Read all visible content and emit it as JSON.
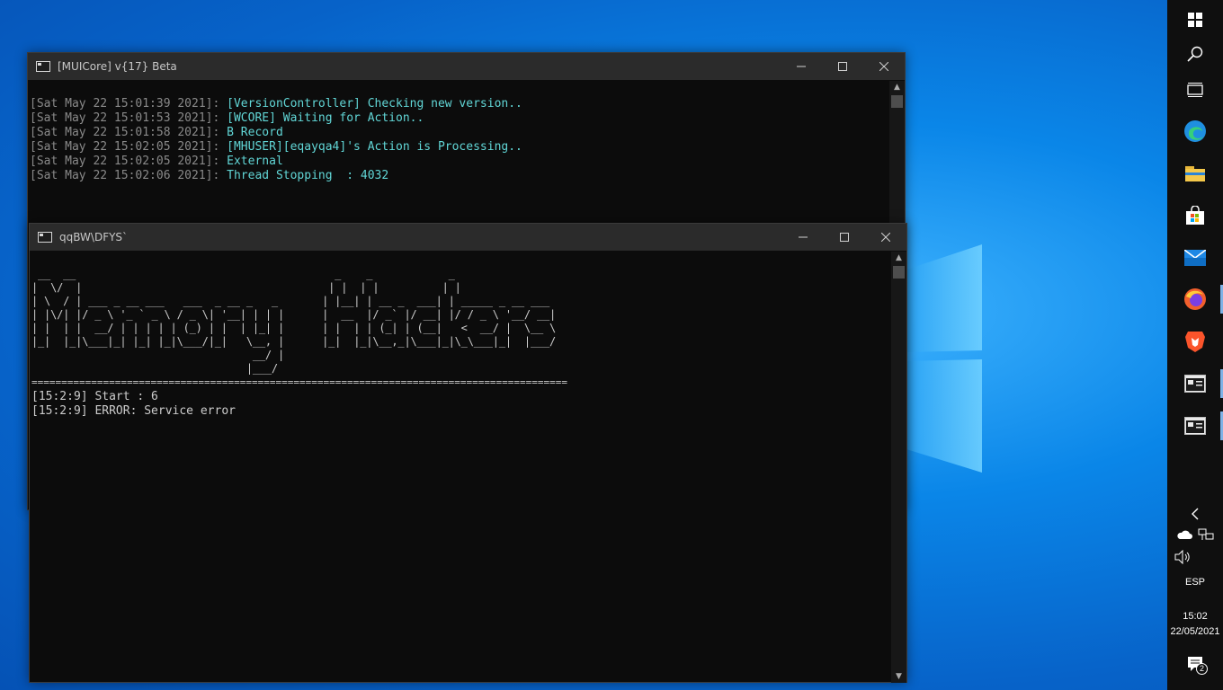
{
  "window1": {
    "title": "[MUICore] v{17} Beta",
    "lines": [
      {
        "ts": "[Sat May 22 15:01:39 2021]: ",
        "msg": "[VersionController] Checking new version.."
      },
      {
        "ts": "[Sat May 22 15:01:53 2021]: ",
        "msg": "[WCORE] Waiting for Action.."
      },
      {
        "ts": "[Sat May 22 15:01:58 2021]: ",
        "msg": "B Record"
      },
      {
        "ts": "[Sat May 22 15:02:05 2021]: ",
        "msg": "[MHUSER][eqayqa4]'s Action is Processing.."
      },
      {
        "ts": "[Sat May 22 15:02:05 2021]: ",
        "msg": "External"
      },
      {
        "ts": "[Sat May 22 15:02:06 2021]: ",
        "msg": "Thread Stopping  : 4032"
      }
    ]
  },
  "window2": {
    "title": "qqBW\\DFYS`",
    "banner": " __  __                                         _    _            _\n|  \\/  |                                       | |  | |          | |\n| \\  / | ___ _ __ ___   ___  _ __ _   _       | |__| | __ _  ___| | _____ _ __ ___\n| |\\/| |/ _ \\ '_ ` _ \\ / _ \\| '__| | | |      |  __  |/ _` |/ __| |/ / _ \\ '__/ __|\n| |  | |  __/ | | | | | (_) | |  | |_| |      | |  | | (_| | (__|   <  __/ |  \\__ \\\n|_|  |_|\\___|_| |_| |_|\\___/|_|   \\__, |      |_|  |_|\\__,_|\\___|_|\\_\\___|_|  |___/\n                                   __/ |\n                                  |___/",
    "separator": "==========================================================================================",
    "lines": [
      "[15:2:9] Start : 6",
      "[15:2:9] ERROR: Service error"
    ]
  },
  "tray": {
    "language": "ESP",
    "time": "15:02",
    "date": "22/05/2021",
    "notification_count": "2"
  },
  "icons": {
    "start": "windows-start-icon",
    "search": "search-icon",
    "taskview": "task-view-icon",
    "edge": "edge-icon",
    "explorer": "file-explorer-icon",
    "store": "store-icon",
    "mail": "mail-icon",
    "firefox": "firefox-icon",
    "brave": "brave-icon",
    "console1": "console-icon",
    "console2": "console-icon"
  }
}
